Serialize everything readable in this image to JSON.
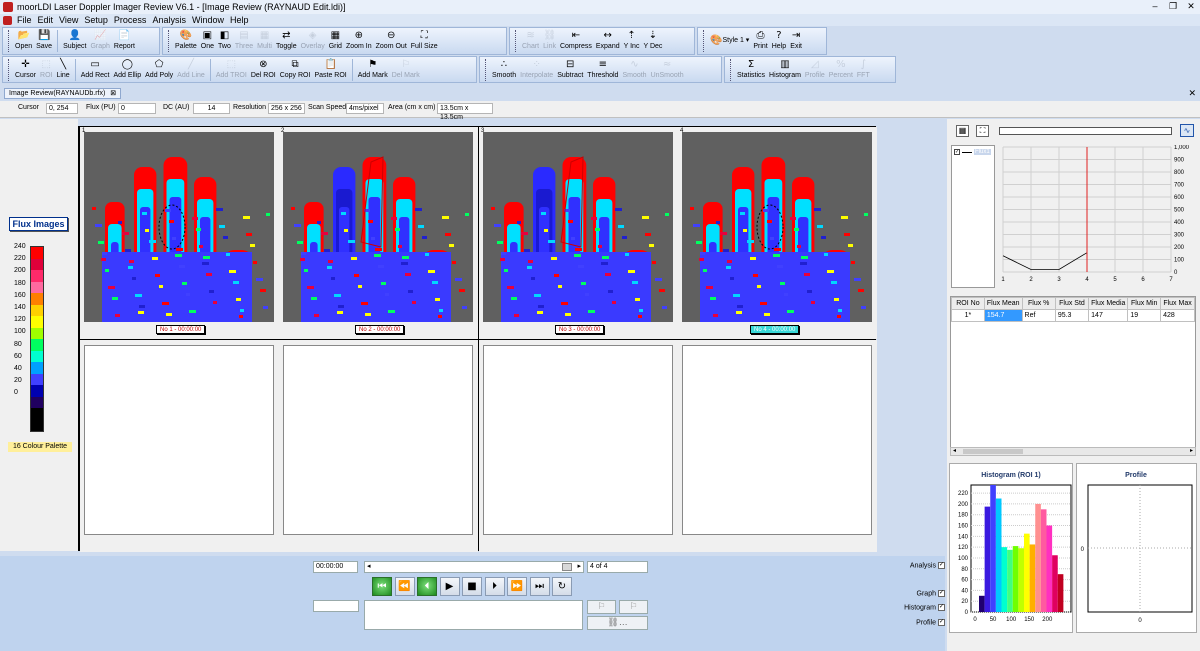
{
  "window": {
    "title": "moorLDI Laser Doppler Imager Review V6.1 - [Image Review (RAYNAUD Edit.ldi)]"
  },
  "menu": [
    "File",
    "Edit",
    "View",
    "Setup",
    "Process",
    "Analysis",
    "Window",
    "Help"
  ],
  "toolbar1": {
    "group1": [
      {
        "label": "Open",
        "icon": "folder-open-icon",
        "enabled": true
      },
      {
        "label": "Save",
        "icon": "save-icon",
        "enabled": true
      },
      {
        "label": "Subject",
        "icon": "person-icon",
        "enabled": true
      },
      {
        "label": "Graph",
        "icon": "graph-icon",
        "enabled": false
      },
      {
        "label": "Report",
        "icon": "report-icon",
        "enabled": true
      }
    ],
    "group2": [
      {
        "label": "Palette",
        "icon": "palette-icon",
        "enabled": true
      },
      {
        "label": "One",
        "icon": "one-view-icon",
        "enabled": true
      },
      {
        "label": "Two",
        "icon": "two-view-icon",
        "enabled": true
      },
      {
        "label": "Three",
        "icon": "three-view-icon",
        "enabled": false
      },
      {
        "label": "Multi",
        "icon": "multi-view-icon",
        "enabled": false
      },
      {
        "label": "Toggle",
        "icon": "toggle-icon",
        "enabled": true
      },
      {
        "label": "Overlay",
        "icon": "overlay-icon",
        "enabled": false
      },
      {
        "label": "Grid",
        "icon": "grid-icon",
        "enabled": true
      },
      {
        "label": "Zoom In",
        "icon": "zoom-in-icon",
        "enabled": true
      },
      {
        "label": "Zoom Out",
        "icon": "zoom-out-icon",
        "enabled": true
      },
      {
        "label": "Full Size",
        "icon": "full-size-icon",
        "enabled": true
      }
    ],
    "group3": [
      {
        "label": "Chart",
        "icon": "chart-icon",
        "enabled": false
      },
      {
        "label": "Link",
        "icon": "link-icon",
        "enabled": false
      },
      {
        "label": "Compress",
        "icon": "compress-icon",
        "enabled": true
      },
      {
        "label": "Expand",
        "icon": "expand-icon",
        "enabled": true
      },
      {
        "label": "Y Inc",
        "icon": "y-increase-icon",
        "enabled": true
      },
      {
        "label": "Y Dec",
        "icon": "y-decrease-icon",
        "enabled": true
      }
    ],
    "group4": [
      {
        "label": "Print",
        "icon": "print-icon",
        "enabled": true
      },
      {
        "label": "Help",
        "icon": "help-icon",
        "enabled": true
      },
      {
        "label": "Exit",
        "icon": "exit-icon",
        "enabled": true
      }
    ],
    "style_label": "Style 1"
  },
  "toolbar2": {
    "group1": [
      {
        "label": "Cursor",
        "icon": "cursor-icon",
        "enabled": true
      },
      {
        "label": "ROI",
        "icon": "roi-icon",
        "enabled": false
      },
      {
        "label": "Line",
        "icon": "line-icon",
        "enabled": true
      },
      {
        "label": "Add Rect",
        "icon": "add-rect-icon",
        "enabled": true
      },
      {
        "label": "Add Ellip",
        "icon": "add-ellipse-icon",
        "enabled": true
      },
      {
        "label": "Add Poly",
        "icon": "add-poly-icon",
        "enabled": true
      },
      {
        "label": "Add Line",
        "icon": "add-line-icon",
        "enabled": false
      },
      {
        "label": "Add TROI",
        "icon": "add-troi-icon",
        "enabled": false
      },
      {
        "label": "Del ROI",
        "icon": "delete-roi-icon",
        "enabled": true
      },
      {
        "label": "Copy ROI",
        "icon": "copy-roi-icon",
        "enabled": true
      },
      {
        "label": "Paste ROI",
        "icon": "paste-roi-icon",
        "enabled": true
      },
      {
        "label": "Add Mark",
        "icon": "add-mark-icon",
        "enabled": true
      },
      {
        "label": "Del Mark",
        "icon": "delete-mark-icon",
        "enabled": false
      }
    ],
    "group2": [
      {
        "label": "Smooth",
        "icon": "smooth-icon",
        "enabled": true
      },
      {
        "label": "Interpolate",
        "icon": "interpolate-icon",
        "enabled": false
      },
      {
        "label": "Subtract",
        "icon": "subtract-icon",
        "enabled": true
      },
      {
        "label": "Threshold",
        "icon": "threshold-icon",
        "enabled": true
      },
      {
        "label": "Smooth",
        "icon": "tc-smooth-icon",
        "enabled": false
      },
      {
        "label": "UnSmooth",
        "icon": "tc-unsmooth-icon",
        "enabled": false
      }
    ],
    "group3": [
      {
        "label": "Statistics",
        "icon": "statistics-icon",
        "enabled": true
      },
      {
        "label": "Histogram",
        "icon": "histogram-icon",
        "enabled": true
      },
      {
        "label": "Profile",
        "icon": "profile-icon",
        "enabled": false
      },
      {
        "label": "Percent",
        "icon": "percent-icon",
        "enabled": false
      },
      {
        "label": "FFT",
        "icon": "fft-icon",
        "enabled": false
      }
    ]
  },
  "tab": {
    "label": "Image Review(RAYNAUDb.rfx)"
  },
  "info": {
    "cursor_label": "Cursor",
    "cursor_value": "0, 254",
    "flux_label": "Flux (PU)",
    "flux_value": "0",
    "dc_label": "DC (AU)",
    "dc_value": "14",
    "res_label": "Resolution",
    "res_value": "256 x 256",
    "scan_label": "Scan Speed",
    "scan_value": "4ms/pixel",
    "area_label": "Area (cm x cm)",
    "area_value": "13.5cm x 13.5cm"
  },
  "left": {
    "title": "Flux Images",
    "palette_labels": [
      "240",
      "220",
      "200",
      "180",
      "160",
      "140",
      "120",
      "100",
      "80",
      "60",
      "40",
      "20",
      "0"
    ],
    "palette_colors": [
      "#ff0000",
      "#e0003a",
      "#ff2a6a",
      "#ff6aa0",
      "#ff7f00",
      "#ffd000",
      "#ffff00",
      "#a0ff00",
      "#00ff60",
      "#00ffd0",
      "#00a0ff",
      "#4040ff",
      "#0000b0",
      "#200060",
      "#000000",
      "#000000"
    ],
    "palette_name": "16 Colour Palette"
  },
  "images": [
    {
      "num": "1",
      "caption": "No 1 - 00:00:00",
      "active": false
    },
    {
      "num": "2",
      "caption": "No 2 - 00:00:00",
      "active": false
    },
    {
      "num": "3",
      "caption": "No 3 - 00:00:00",
      "active": false
    },
    {
      "num": "4",
      "caption": "No 4 - 00:00:00",
      "active": true
    }
  ],
  "graph": {
    "legend_item": "Flux1",
    "x_ticks": [
      "1",
      "2",
      "3",
      "4",
      "5",
      "6",
      "7"
    ],
    "y_ticks": [
      "1,000",
      "900",
      "800",
      "700",
      "600",
      "500",
      "400",
      "300",
      "200",
      "100",
      "0"
    ],
    "series_points": [
      [
        1,
        130
      ],
      [
        2,
        20
      ],
      [
        3,
        20
      ],
      [
        4,
        154.7
      ]
    ],
    "marker_x": 4,
    "xlim": [
      1,
      7
    ],
    "ylim": [
      0,
      1000
    ]
  },
  "roi_table": {
    "headers": [
      "ROI No",
      "Flux Mean",
      "Flux %",
      "Flux Std",
      "Flux Media",
      "Flux Min",
      "Flux Max"
    ],
    "rows": [
      [
        "1*",
        "154.7",
        "Ref",
        "95.3",
        "147",
        "19",
        "428"
      ]
    ]
  },
  "chart_data": [
    {
      "type": "bar",
      "title": "Histogram (ROI 1)",
      "categories": [
        "15",
        "30",
        "45",
        "60",
        "75",
        "90",
        "105",
        "120",
        "135",
        "150",
        "165",
        "180",
        "195",
        "210",
        "225",
        "240"
      ],
      "values": [
        30,
        195,
        235,
        210,
        120,
        115,
        122,
        118,
        145,
        125,
        200,
        190,
        160,
        105,
        70,
        0
      ],
      "colors": [
        "#200070",
        "#3a1ae0",
        "#4040ff",
        "#00c8ff",
        "#00ffd0",
        "#40ff80",
        "#70ff00",
        "#c0ff00",
        "#ffff00",
        "#ffb000",
        "#ff9090",
        "#ff5aa0",
        "#ff30c0",
        "#e00060",
        "#c00020",
        "#ff0000"
      ],
      "y_ticks": [
        "0",
        "20",
        "40",
        "60",
        "80",
        "100",
        "120",
        "140",
        "160",
        "180",
        "200",
        "220"
      ],
      "x_ticks": [
        "0",
        "50",
        "100",
        "150",
        "200"
      ],
      "ylim": [
        0,
        235
      ]
    },
    {
      "type": "line",
      "title": "Profile",
      "y_ticks": [
        "0"
      ],
      "x_ticks": [
        "0"
      ]
    }
  ],
  "playback": {
    "time_value": "00:00:00",
    "frame_value": "4 of 4",
    "buttons": [
      {
        "name": "first-frame-button",
        "glyph": "⏮",
        "green": true
      },
      {
        "name": "rewind-button",
        "glyph": "⏪",
        "green": false
      },
      {
        "name": "step-back-button",
        "glyph": "⏴",
        "green": true
      },
      {
        "name": "play-button",
        "glyph": "▶",
        "green": false
      },
      {
        "name": "stop-button",
        "glyph": "■",
        "green": false
      },
      {
        "name": "step-forward-button",
        "glyph": "⏵",
        "green": false
      },
      {
        "name": "fast-forward-button",
        "glyph": "⏩",
        "green": false
      },
      {
        "name": "last-frame-button",
        "glyph": "⏭",
        "green": false
      },
      {
        "name": "loop-button",
        "glyph": "↻",
        "green": false
      }
    ],
    "checks": [
      {
        "label": "Analysis",
        "checked": true
      },
      {
        "label": "Graph",
        "checked": true
      },
      {
        "label": "Histogram",
        "checked": true
      },
      {
        "label": "Profile",
        "checked": true
      }
    ]
  }
}
